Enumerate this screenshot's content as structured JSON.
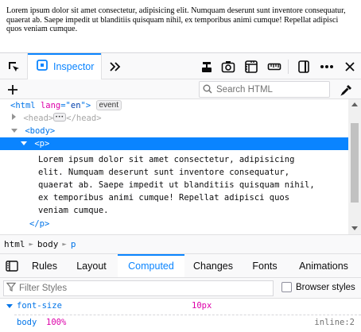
{
  "page": {
    "paragraph": "Lorem ipsum dolor sit amet consectetur, adipisicing elit. Numquam deserunt sunt inventore consequatur, quaerat ab. Saepe impedit ut blanditiis quisquam nihil, ex temporibus animi cumque! Repellat adipisci quos veniam cumque."
  },
  "toolbar": {
    "inspector_label": "Inspector"
  },
  "search": {
    "placeholder": "Search HTML"
  },
  "markup": {
    "html_open_tag": "<html",
    "html_attr_name": "lang",
    "html_attr_eq": "=\"",
    "html_attr_value": "en",
    "html_attr_close": "\">",
    "event_badge": "event",
    "head_open": "<head>",
    "head_close": "</head>",
    "body_open": "<body>",
    "p_open": "<p>",
    "p_text": "Lorem ipsum dolor sit amet consectetur, adipisicing\nelit. Numquam deserunt sunt inventore consequatur,\nquaerat ab. Saepe impedit ut blanditiis quisquam nihil,\nex temporibus animi cumque! Repellat adipisci quos\nveniam cumque.",
    "p_close": "</p>"
  },
  "breadcrumbs": [
    "html",
    "body",
    "p"
  ],
  "sidebar_tabs": [
    "Rules",
    "Layout",
    "Computed",
    "Changes",
    "Fonts",
    "Animations"
  ],
  "filter": {
    "placeholder": "Filter Styles",
    "browser_styles_label": "Browser styles"
  },
  "computed": {
    "property": "font-size",
    "value": "10px",
    "match_selector": "body",
    "match_value": "100%",
    "match_source": "inline:2"
  },
  "colors": {
    "accent": "#0a84ff",
    "tag": "#0074e8",
    "attr_name": "#dd00a9"
  }
}
